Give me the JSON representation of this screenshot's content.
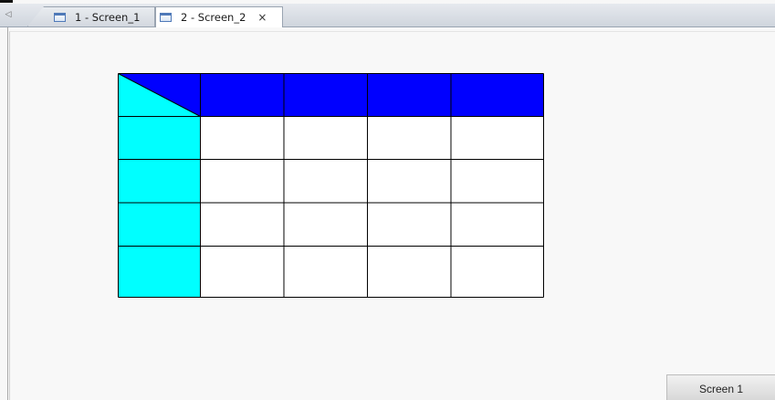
{
  "tabs": [
    {
      "label": "1 - Screen_1",
      "active": false,
      "icon": "screen-icon"
    },
    {
      "label": "2 - Screen_2",
      "active": true,
      "icon": "screen-icon",
      "close_glyph": "×"
    }
  ],
  "scroll_left_glyph": "◁",
  "table": {
    "rows": 5,
    "columns": 5,
    "header_color": "#0000ff",
    "first_column_color": "#00ffff",
    "header_cell_color": "#0000ff",
    "corner_diagonal": true,
    "body_color": "#ffffff",
    "grid_color": "#000000"
  },
  "screen_button": {
    "label": "Screen 1"
  },
  "colors": {
    "canvas_background": "#f8f8f8",
    "tab_active": "#ffffff"
  }
}
